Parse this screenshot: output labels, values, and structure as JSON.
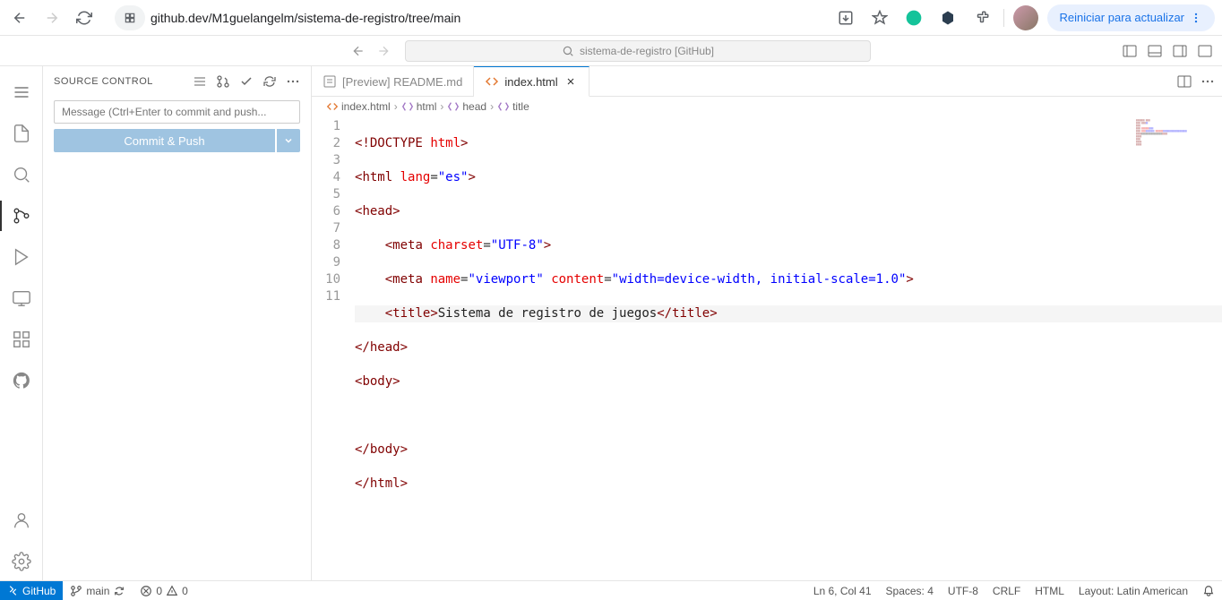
{
  "browser": {
    "url": "github.dev/M1guelangelm/sistema-de-registro/tree/main",
    "restart_label": "Reiniciar para actualizar"
  },
  "vscode": {
    "search_placeholder": "sistema-de-registro [GitHub]",
    "sidebar": {
      "title": "SOURCE CONTROL",
      "commit_placeholder": "Message (Ctrl+Enter to commit and push...",
      "commit_button": "Commit & Push"
    },
    "tabs": [
      {
        "label": "[Preview] README.md",
        "icon": "preview",
        "active": false
      },
      {
        "label": "index.html",
        "icon": "html",
        "active": true
      }
    ],
    "breadcrumb": [
      {
        "label": "index.html",
        "icon": "file"
      },
      {
        "label": "html",
        "icon": "brackets"
      },
      {
        "label": "head",
        "icon": "brackets"
      },
      {
        "label": "title",
        "icon": "brackets"
      }
    ],
    "code": {
      "lines": [
        1,
        2,
        3,
        4,
        5,
        6,
        7,
        8,
        9,
        10,
        11
      ],
      "highlighted_line": 6,
      "content": {
        "line1": "<!DOCTYPE html>",
        "line6_text": "Sistema de registro de juegos"
      }
    },
    "status": {
      "remote": "GitHub",
      "branch": "main",
      "errors": "0",
      "warnings": "0",
      "ln_col": "Ln 6, Col 41",
      "spaces": "Spaces: 4",
      "encoding": "UTF-8",
      "eol": "CRLF",
      "lang": "HTML",
      "layout": "Layout: Latin American"
    }
  }
}
